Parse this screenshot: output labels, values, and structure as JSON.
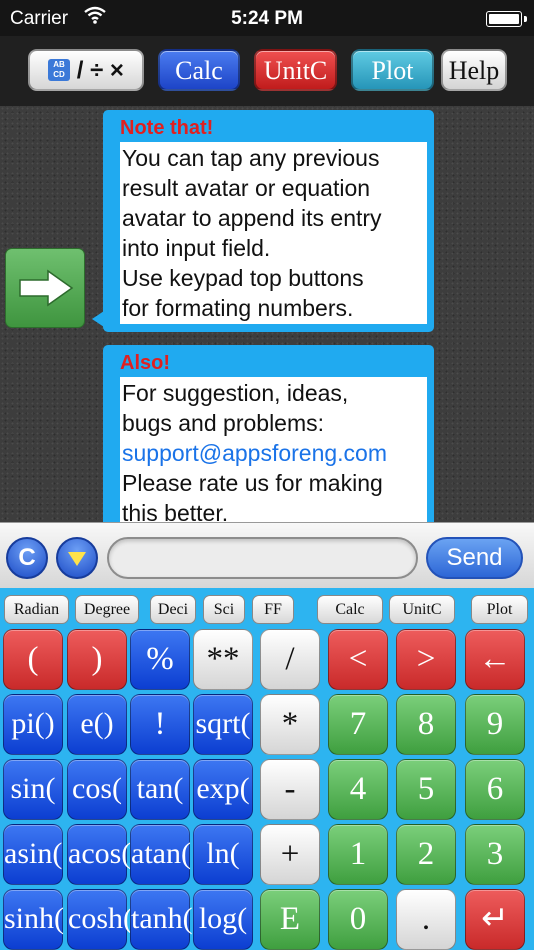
{
  "status_bar": {
    "carrier": "Carrier",
    "time": "5:24 PM"
  },
  "toolbar": {
    "format_label": "/ ÷ ×",
    "format_icon_text": "AB CD",
    "calc": "Calc",
    "unitc": "UnitC",
    "plot": "Plot",
    "help": "Help"
  },
  "chat": {
    "messages": [
      {
        "title": "Note that!",
        "lines": [
          "You can tap any previous",
          "result avatar or equation",
          "avatar to append its entry",
          "into input field.",
          "Use keypad top buttons",
          "for formating numbers."
        ]
      },
      {
        "title": "Also!",
        "lines": [
          "For suggestion, ideas,",
          "bugs and problems:",
          "support@appsforeng.com",
          "Please rate us for making",
          "this better."
        ]
      }
    ]
  },
  "input": {
    "clear_label": "C",
    "value": "",
    "placeholder": "",
    "send_label": "Send"
  },
  "keypad": {
    "modes": [
      "Radian",
      "Degree",
      "Deci",
      "Sci",
      "FF",
      "Calc",
      "UnitC",
      "Plot"
    ],
    "rows": [
      [
        "(",
        ")",
        "%",
        "**",
        "/",
        "<",
        ">",
        "←"
      ],
      [
        "pi()",
        "e()",
        "!",
        "sqrt(",
        "*",
        "7",
        "8",
        "9"
      ],
      [
        "sin(",
        "cos(",
        "tan(",
        "exp(",
        "-",
        "4",
        "5",
        "6"
      ],
      [
        "asin(",
        "acos(",
        "atan(",
        "ln(",
        "+",
        "1",
        "2",
        "3"
      ],
      [
        "sinh(",
        "cosh(",
        "tanh(",
        "log(",
        "E",
        "0",
        ".",
        "↵"
      ]
    ],
    "colors": {
      "red": "#d93c3c",
      "blue": "#1f55e0",
      "green": "#52ad52",
      "white": "#f0f0f0",
      "panel": "#2db4f0"
    }
  }
}
